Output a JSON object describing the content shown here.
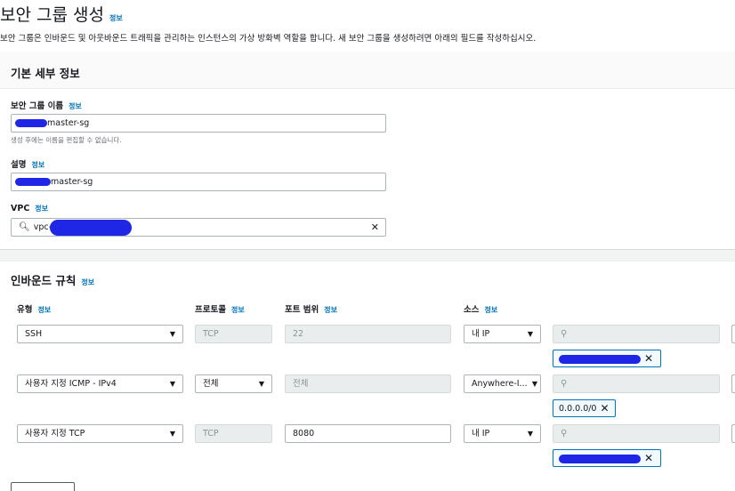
{
  "page": {
    "title": "보안 그룹 생성",
    "info_label": "정보",
    "description": "보안 그룹은 인바운드 및 아웃바운드 트래픽을 관리하는 인스턴스의 가상 방화벽 역할을 합니다. 새 보안 그룹을 생성하려면 아래의 필드를 작성하십시오."
  },
  "basic": {
    "title": "기본 세부 정보",
    "name_label": "보안 그룹 이름",
    "name_value": "master-sg",
    "name_hint": "생성 후에는 이름을 편집할 수 없습니다.",
    "desc_label": "설명",
    "desc_value": "master-sg",
    "vpc_label": "VPC",
    "vpc_value": "vpc-",
    "clear_icon": "✕"
  },
  "inbound": {
    "title": "인바운드 규칙",
    "columns": {
      "type": "유형",
      "protocol": "프로토콜",
      "port": "포트 범위",
      "source": "소스"
    },
    "rules": [
      {
        "type": "SSH",
        "protocol": "TCP",
        "port": "22",
        "source": "내 IP",
        "token": ""
      },
      {
        "type": "사용자 지정 ICMP - IPv4",
        "protocol": "전체",
        "port": "전체",
        "source": "Anywhere-I...",
        "token": "0.0.0.0/0"
      },
      {
        "type": "사용자 지정 TCP",
        "protocol": "TCP",
        "port": "8080",
        "source": "내 IP",
        "token": ""
      }
    ],
    "search_icon": "⚲"
  },
  "colors": {
    "link": "#0073bb",
    "redaction": "#1f26e6",
    "panel_header": "#fafafa"
  }
}
